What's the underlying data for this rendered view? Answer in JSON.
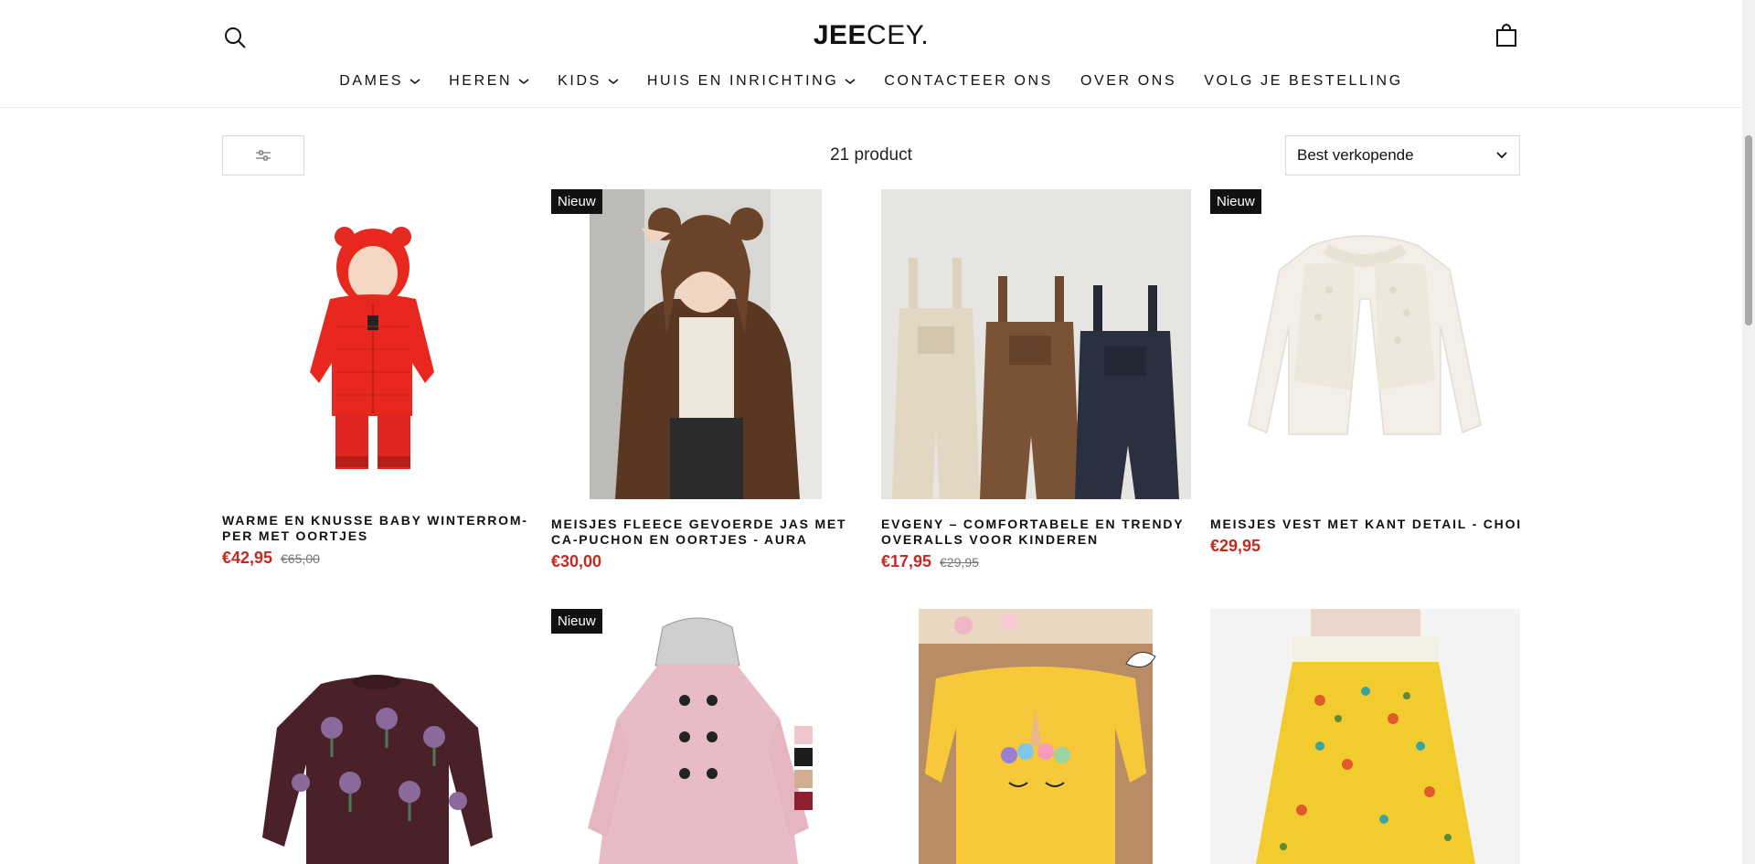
{
  "header": {
    "logo_bold": "JEE",
    "logo_light": "CEY.",
    "nav": [
      {
        "label": "DAMES",
        "has_dropdown": true
      },
      {
        "label": "HEREN",
        "has_dropdown": true
      },
      {
        "label": "KIDS",
        "has_dropdown": true
      },
      {
        "label": "HUIS EN INRICHTING",
        "has_dropdown": true
      },
      {
        "label": "CONTACTEER ONS",
        "has_dropdown": false
      },
      {
        "label": "OVER ONS",
        "has_dropdown": false
      },
      {
        "label": "VOLG JE BESTELLING",
        "has_dropdown": false
      }
    ]
  },
  "toolbar": {
    "product_count": "21 product",
    "sort_selected": "Best verkopende"
  },
  "products": [
    {
      "title": "WARME EN KNUSSE BABY WINTERROM-PER MET OORTJES",
      "price": "€42,95",
      "compare_price": "€65,00",
      "badge": ""
    },
    {
      "title": "MEISJES FLEECE GEVOERDE JAS MET CA-PUCHON EN OORTJES - AURA",
      "price": "€30,00",
      "compare_price": "",
      "badge": "Nieuw"
    },
    {
      "title": "EVGENY – COMFORTABELE EN TRENDY OVERALLS VOOR KINDEREN",
      "price": "€17,95",
      "compare_price": "€29,95",
      "badge": ""
    },
    {
      "title": "MEISJES VEST MET KANT DETAIL - CHOI",
      "price": "€29,95",
      "compare_price": "",
      "badge": "Nieuw"
    },
    {
      "title": "",
      "price": "",
      "compare_price": "",
      "badge": ""
    },
    {
      "title": "",
      "price": "",
      "compare_price": "",
      "badge": "Nieuw"
    },
    {
      "title": "",
      "price": "",
      "compare_price": "",
      "badge": ""
    },
    {
      "title": "",
      "price": "",
      "compare_price": "",
      "badge": ""
    }
  ],
  "icons": {
    "search": "search-icon",
    "cart": "shopping-bag-icon",
    "filter": "sliders-icon",
    "sort": "chevron-down-icon"
  },
  "colors": {
    "sale_price": "#c52a20",
    "badge_bg": "#111111",
    "text": "#111111"
  }
}
